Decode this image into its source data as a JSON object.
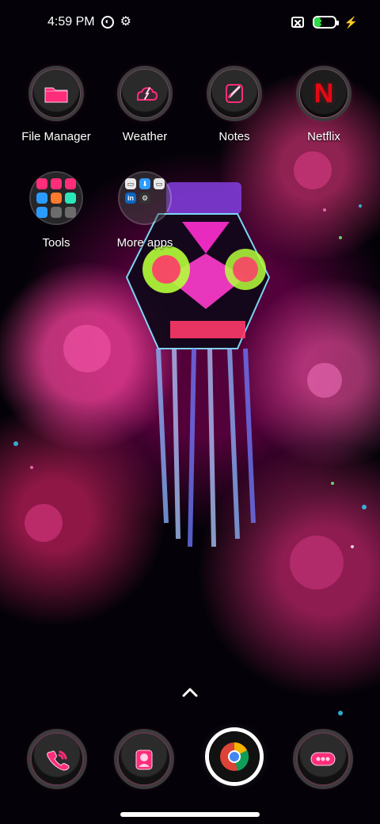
{
  "status_bar": {
    "time": "4:59 PM",
    "battery_level": "35",
    "icons": [
      "dnd-circle-icon",
      "gear-icon",
      "sim-x-icon",
      "battery-icon",
      "charging-bolt-icon"
    ]
  },
  "apps": [
    {
      "label": "File Manager",
      "icon": "folder-icon"
    },
    {
      "label": "Weather",
      "icon": "weather-icon"
    },
    {
      "label": "Notes",
      "icon": "notes-icon"
    },
    {
      "label": "Netflix",
      "icon": "netflix-icon",
      "letter": "N"
    }
  ],
  "folders": [
    {
      "label": "Tools",
      "icon": "tools-folder-icon"
    },
    {
      "label": "More apps",
      "icon": "more-apps-folder-icon"
    }
  ],
  "more_apps_letters": [
    "in"
  ],
  "dock": [
    {
      "icon": "phone-icon"
    },
    {
      "icon": "contacts-icon"
    },
    {
      "icon": "chrome-icon"
    },
    {
      "icon": "messages-icon"
    }
  ],
  "colors": {
    "accent_pink": "#ff2d7a",
    "battery_green": "#2fdb47",
    "netflix_red": "#e50914"
  }
}
